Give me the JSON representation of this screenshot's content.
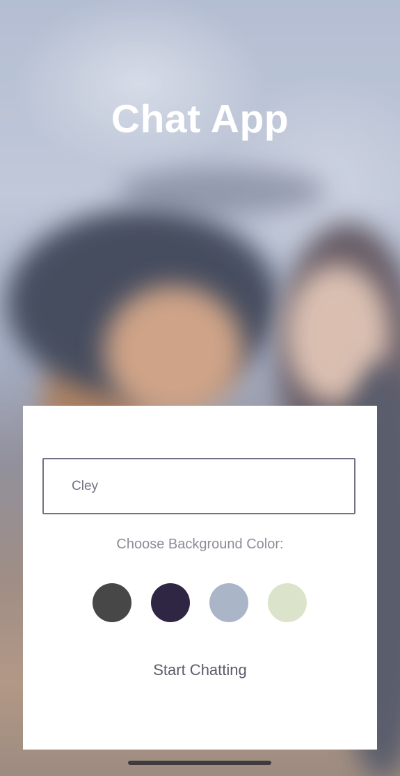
{
  "app": {
    "title": "Chat App"
  },
  "form": {
    "name_value": "Cley",
    "choose_label": "Choose Background Color:",
    "colors": [
      "#474747",
      "#2f2644",
      "#abb5c8",
      "#dbe4ca"
    ],
    "start_label": "Start Chatting"
  }
}
